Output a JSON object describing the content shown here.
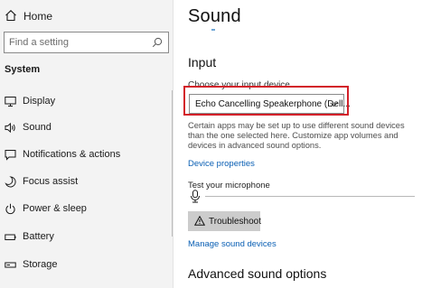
{
  "sidebar": {
    "home_label": "Home",
    "search_placeholder": "Find a setting",
    "section_title": "System",
    "items": [
      {
        "label": "Display",
        "icon": "monitor-icon"
      },
      {
        "label": "Sound",
        "icon": "speaker-icon"
      },
      {
        "label": "Notifications & actions",
        "icon": "notification-icon"
      },
      {
        "label": "Focus assist",
        "icon": "moon-icon"
      },
      {
        "label": "Power & sleep",
        "icon": "power-icon"
      },
      {
        "label": "Battery",
        "icon": "battery-icon"
      },
      {
        "label": "Storage",
        "icon": "storage-icon"
      }
    ]
  },
  "main": {
    "title": "Sound",
    "input_heading": "Input",
    "choose_device_label": "Choose your input device",
    "selected_device": "Echo Cancelling Speakerphone (Dell...",
    "description": "Certain apps may be set up to use different sound devices than the one selected here. Customize app volumes and devices in advanced sound options.",
    "device_properties_link": "Device properties",
    "test_mic_label": "Test your microphone",
    "troubleshoot_label": "Troubleshoot",
    "manage_devices_link": "Manage sound devices",
    "advanced_heading": "Advanced sound options"
  },
  "colors": {
    "accent_link": "#0a5fb4",
    "highlight_box": "#d32029"
  }
}
